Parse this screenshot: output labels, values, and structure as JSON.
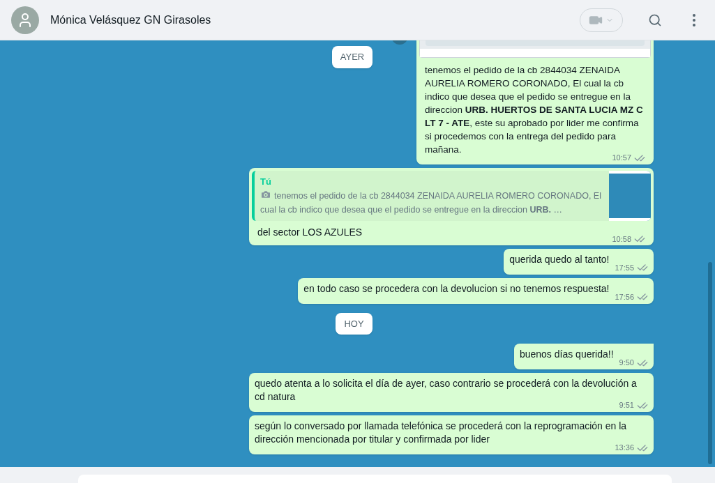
{
  "header": {
    "contact_name": "Mónica Velásquez GN Girasoles"
  },
  "messages": [
    {
      "kind": "date",
      "text": "AYER",
      "sticky": true
    },
    {
      "kind": "image",
      "text": "tenemos el pedido de la cb 2844034 ZENAIDA AURELIA ROMERO CORONADO, El cual la cb indico que desea que el pedido se entregue en la direccion **URB. HUERTOS DE SANTA LUCIA MZ C LT 7 - ATE**, este su aprobado por lider me confirma si procedemos con la entrega del pedido para mañana.",
      "time": "10:57",
      "read": false
    },
    {
      "kind": "reply",
      "quote_author": "Tú",
      "quote_text": "tenemos el pedido de la cb 2844034 ZENAIDA AURELIA ROMERO CORONADO, El cual la cb indico que desea que el pedido se entregue en la direccion **URB.** …",
      "text": "del sector LOS AZULES",
      "time": "10:58",
      "read": false
    },
    {
      "kind": "text",
      "text": "querida quedo al tanto!",
      "time": "17:55",
      "read": false
    },
    {
      "kind": "text",
      "text": "en todo caso se procedera con la devolucion si no tenemos respuesta!",
      "time": "17:56",
      "read": false
    },
    {
      "kind": "date",
      "text": "HOY",
      "sticky": false
    },
    {
      "kind": "text",
      "text": "buenos días querida!!",
      "time": "9:50",
      "read": false,
      "tail": true
    },
    {
      "kind": "text",
      "text": "quedo atenta a lo solicita el día de ayer, caso contrario se procederá con la devolución a cd natura",
      "time": "9:51",
      "read": false
    },
    {
      "kind": "text",
      "text": "según lo conversado por llamada telefónica se procederá con la reprogramación en la dirección mencionada por titular y confirmada por lider",
      "time": "13:36",
      "read": false
    }
  ]
}
